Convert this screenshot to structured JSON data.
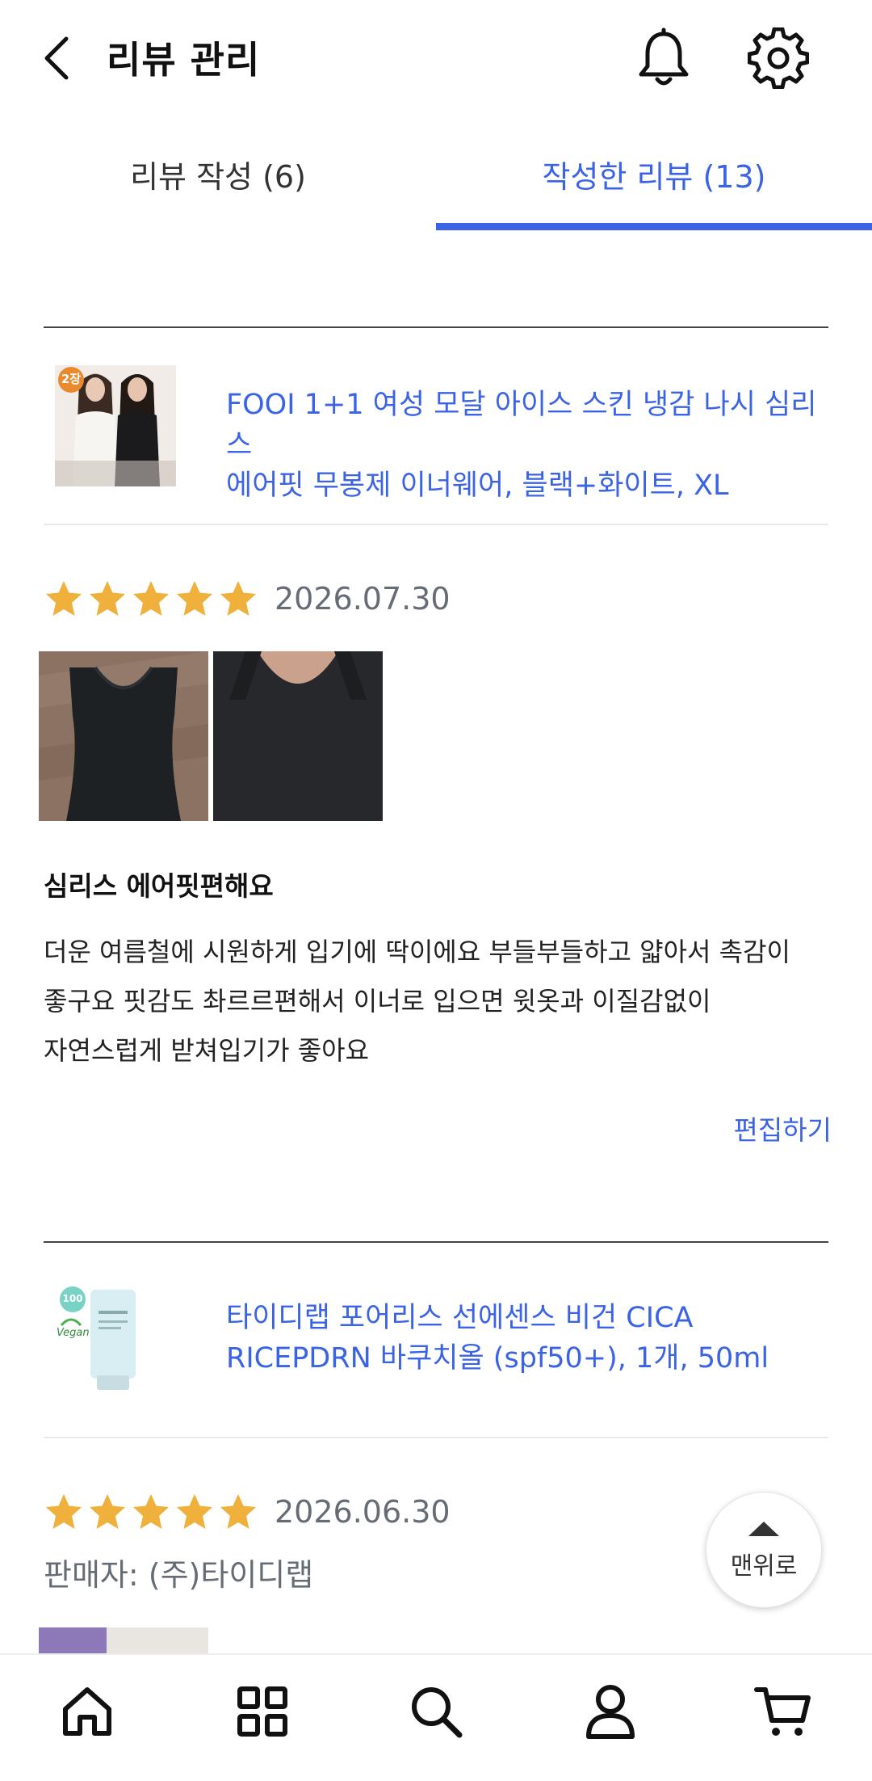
{
  "header": {
    "title": "리뷰 관리"
  },
  "tabs": [
    {
      "label": "리뷰 작성 (6)",
      "active": false
    },
    {
      "label": "작성한 리뷰 (13)",
      "active": true
    }
  ],
  "reviews": [
    {
      "product_name_line1": "FOOI 1+1 여성 모달 아이스 스킨 냉감 나시 심리스",
      "product_name_line2": "에어핏 무봉제 이너웨어, 블랙+화이트, XL",
      "thumb_badge": "2장",
      "rating": 5,
      "date": "2026.07.30",
      "title": "심리스 에어핏편해요",
      "body_lines": [
        "더운 여름철에 시원하게 입기에 딱이에요 부들부들하고 얇아서 촉감이",
        "좋구요 핏감도 촤르르편해서 이너로 입으면 윗옷과 이질감없이",
        "자연스럽게 받쳐입기가 좋아요"
      ],
      "edit_label": "편집하기"
    },
    {
      "product_name_line1": "타이디랩 포어리스 선에센스 비건 CICA",
      "product_name_line2": "RICEPDRN 바쿠치올 (spf50+), 1개, 50ml",
      "thumb_badge": "100",
      "thumb_badge2": "Vegan",
      "rating": 5,
      "date": "2026.06.30",
      "seller": "판매자: (주)타이디랩"
    }
  ],
  "back_to_top": {
    "label": "맨위로"
  },
  "colors": {
    "accent": "#3b63e6",
    "star": "#f0b03c",
    "muted": "#666c75"
  },
  "bottom_nav": {
    "items": [
      "home-icon",
      "grid-icon",
      "search-icon",
      "user-icon",
      "cart-icon"
    ]
  }
}
